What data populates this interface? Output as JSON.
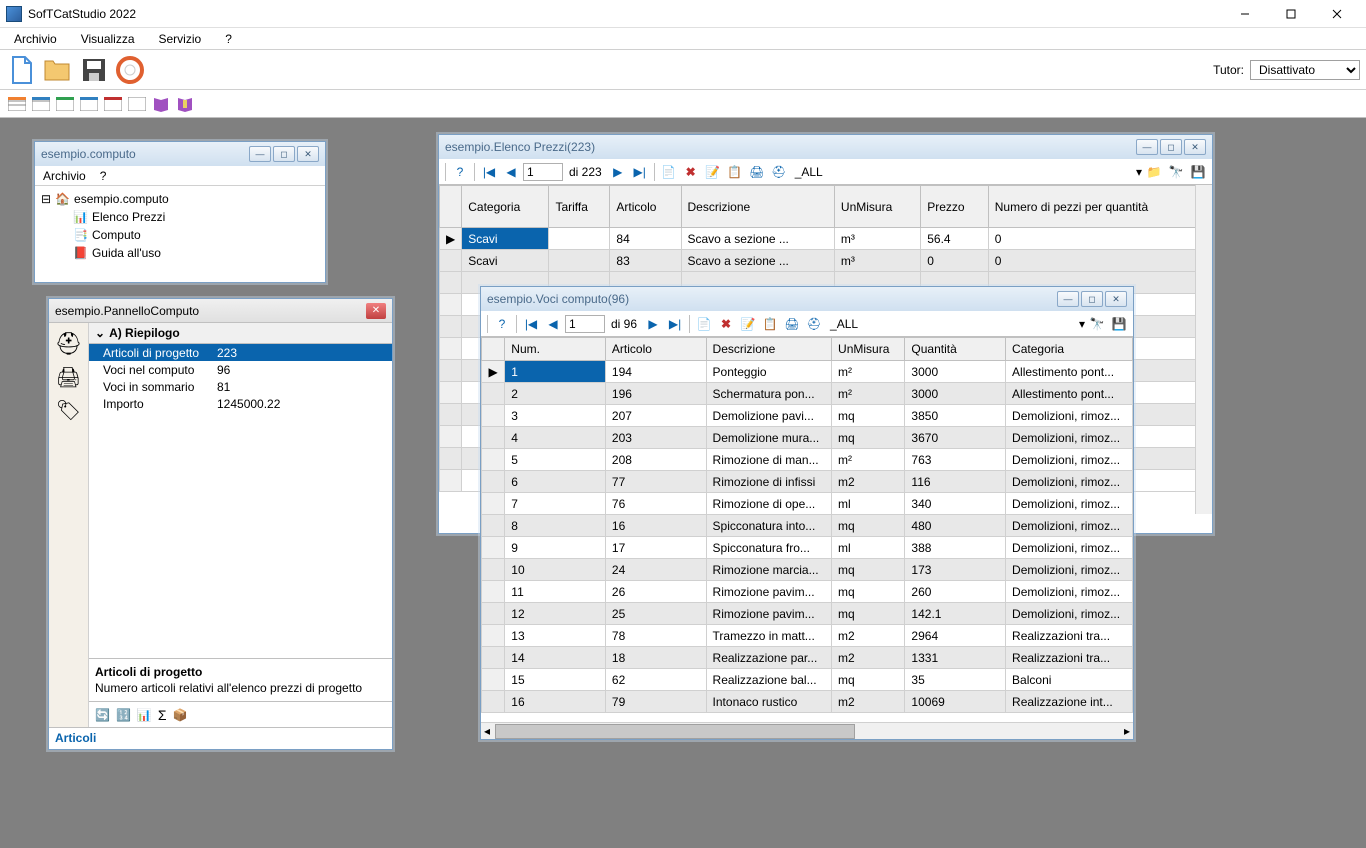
{
  "app": {
    "title": "SofTCatStudio 2022"
  },
  "menu": {
    "archivio": "Archivio",
    "visualizza": "Visualizza",
    "servizio": "Servizio",
    "help": "?"
  },
  "tutor": {
    "label": "Tutor:",
    "value": "Disattivato"
  },
  "computo": {
    "title": "esempio.computo",
    "menu_archivio": "Archivio",
    "menu_help": "?",
    "tree": {
      "root": "esempio.computo",
      "elenco": "Elenco Prezzi",
      "computo": "Computo",
      "guida": "Guida all'uso"
    }
  },
  "pannello": {
    "title": "esempio.PannelloComputo",
    "section": "A) Riepilogo",
    "rows": [
      {
        "k": "Articoli di progetto",
        "v": "223"
      },
      {
        "k": "Voci nel computo",
        "v": "96"
      },
      {
        "k": "Voci in sommario",
        "v": "81"
      },
      {
        "k": "Importo",
        "v": "1245000.22"
      }
    ],
    "desc_hdr": "Articoli di progetto",
    "desc_txt": "Numero articoli relativi all'elenco prezzi di progetto",
    "status": "Articoli"
  },
  "elenco": {
    "title": "esempio.Elenco Prezzi(223)",
    "nav": {
      "pos": "1",
      "total": "di 223",
      "filter": "_ALL"
    },
    "cols": [
      "Categoria",
      "Tariffa",
      "Articolo",
      "Descrizione",
      "UnMisura",
      "Prezzo",
      "Numero di pezzi per quantità"
    ],
    "rows": [
      {
        "c": [
          "Scavi",
          "",
          "84",
          "Scavo a sezione ...",
          "m³",
          "56.4",
          "0"
        ],
        "sel": true
      },
      {
        "c": [
          "Scavi",
          "",
          "83",
          "Scavo a sezione ...",
          "m³",
          "0",
          "0"
        ]
      }
    ]
  },
  "voci": {
    "title": "esempio.Voci computo(96)",
    "nav": {
      "pos": "1",
      "total": "di 96",
      "filter": "_ALL"
    },
    "cols": [
      "Num.",
      "Articolo",
      "Descrizione",
      "UnMisura",
      "Quantità",
      "Categoria"
    ],
    "rows": [
      {
        "c": [
          "1",
          "194",
          "Ponteggio",
          "m²",
          "3000",
          "Allestimento pont..."
        ],
        "sel": true
      },
      {
        "c": [
          "2",
          "196",
          "Schermatura pon...",
          "m²",
          "3000",
          "Allestimento pont..."
        ]
      },
      {
        "c": [
          "3",
          "207",
          "Demolizione pavi...",
          "mq",
          "3850",
          "Demolizioni, rimoz..."
        ]
      },
      {
        "c": [
          "4",
          "203",
          "Demolizione mura...",
          "mq",
          "3670",
          "Demolizioni, rimoz..."
        ]
      },
      {
        "c": [
          "5",
          "208",
          "Rimozione di man...",
          "m²",
          "763",
          "Demolizioni, rimoz..."
        ]
      },
      {
        "c": [
          "6",
          "77",
          "Rimozione di infissi",
          "m2",
          "116",
          "Demolizioni, rimoz..."
        ]
      },
      {
        "c": [
          "7",
          "76",
          "Rimozione di ope...",
          "ml",
          "340",
          "Demolizioni, rimoz..."
        ]
      },
      {
        "c": [
          "8",
          "16",
          "Spicconatura into...",
          "mq",
          "480",
          "Demolizioni, rimoz..."
        ]
      },
      {
        "c": [
          "9",
          "17",
          "Spicconatura fro...",
          "ml",
          "388",
          "Demolizioni, rimoz..."
        ]
      },
      {
        "c": [
          "10",
          "24",
          "Rimozione marcia...",
          "mq",
          "173",
          "Demolizioni, rimoz..."
        ]
      },
      {
        "c": [
          "11",
          "26",
          "Rimozione pavim...",
          "mq",
          "260",
          "Demolizioni, rimoz..."
        ]
      },
      {
        "c": [
          "12",
          "25",
          "Rimozione pavim...",
          "mq",
          "142.1",
          "Demolizioni, rimoz..."
        ]
      },
      {
        "c": [
          "13",
          "78",
          "Tramezzo in matt...",
          "m2",
          "2964",
          "Realizzazioni tra..."
        ]
      },
      {
        "c": [
          "14",
          "18",
          "Realizzazione par...",
          "m2",
          "1331",
          "Realizzazioni tra..."
        ]
      },
      {
        "c": [
          "15",
          "62",
          "Realizzazione bal...",
          "mq",
          "35",
          "Balconi"
        ]
      },
      {
        "c": [
          "16",
          "79",
          "Intonaco rustico",
          "m2",
          "10069",
          "Realizzazione int..."
        ]
      }
    ]
  }
}
